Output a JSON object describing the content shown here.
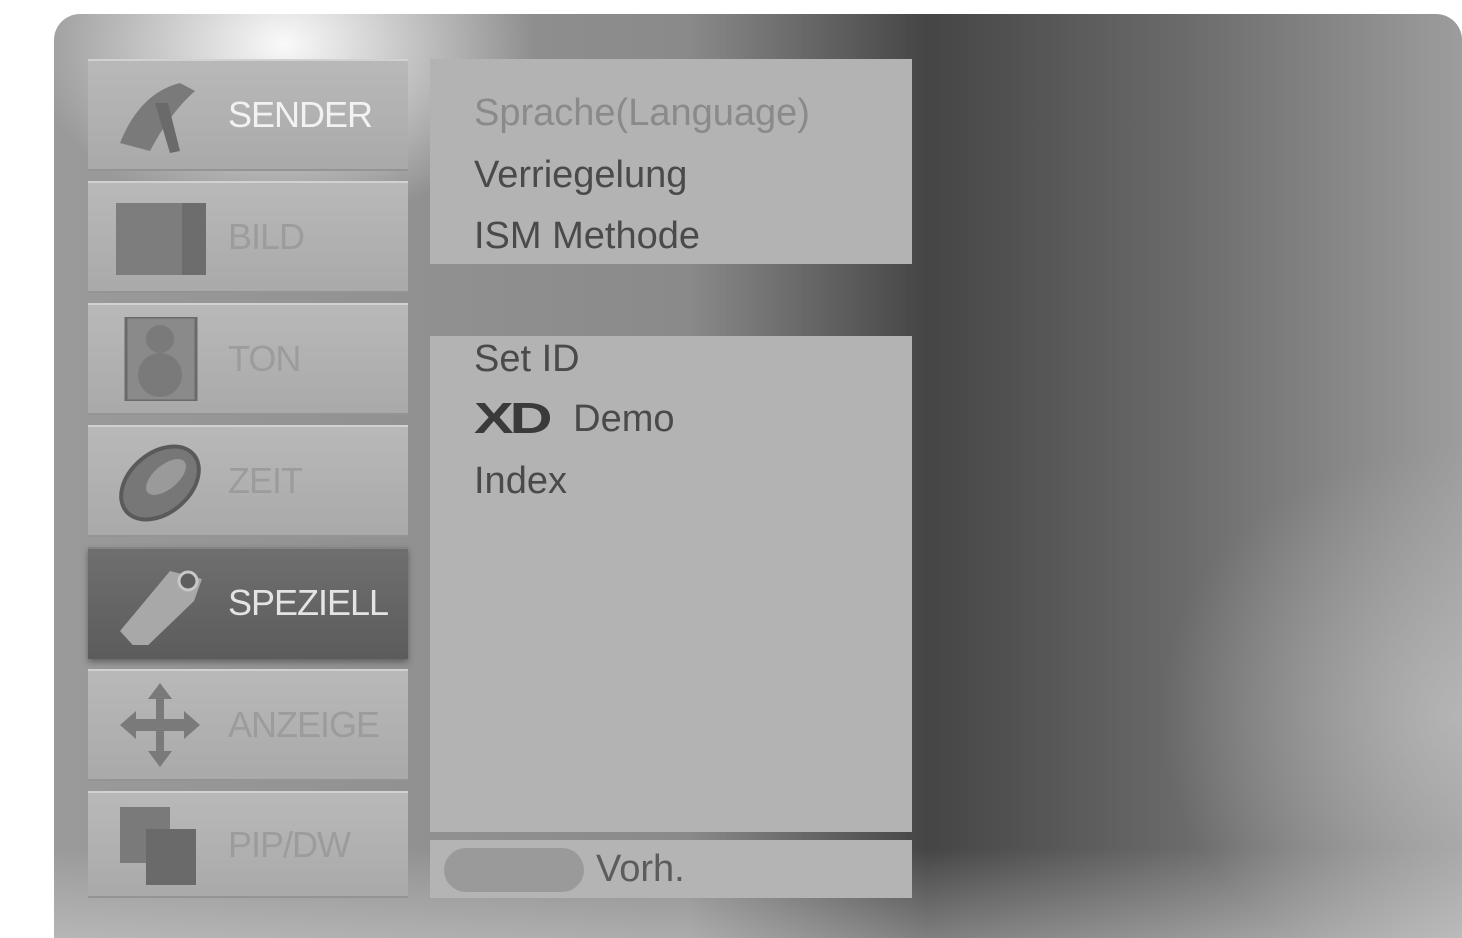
{
  "sidebar": {
    "items": [
      {
        "label": "SENDER",
        "icon": "satellite-dish-icon",
        "state": "normal"
      },
      {
        "label": "BILD",
        "icon": "picture-icon",
        "state": "dim"
      },
      {
        "label": "TON",
        "icon": "speaker-icon",
        "state": "dim"
      },
      {
        "label": "ZEIT",
        "icon": "clock-icon",
        "state": "dim"
      },
      {
        "label": "SPEZIELL",
        "icon": "tag-icon",
        "state": "selected"
      },
      {
        "label": "ANZEIGE",
        "icon": "move-arrows-icon",
        "state": "dim"
      },
      {
        "label": "PIP/DW",
        "icon": "pip-windows-icon",
        "state": "dim"
      }
    ]
  },
  "menu": {
    "top_items": [
      {
        "label": "Sprache(Language)",
        "state": "dim"
      },
      {
        "label": "Verriegelung",
        "state": "normal"
      },
      {
        "label": "ISM Methode",
        "state": "normal"
      }
    ],
    "main_items": [
      {
        "label": "Set ID"
      },
      {
        "logo": "XD",
        "label": "Demo"
      },
      {
        "label": "Index"
      }
    ]
  },
  "footer": {
    "key_color": "#9a9a9a",
    "label": "Vorh."
  },
  "colors": {
    "panel": "#b3b3b3",
    "selected_tab": "#666666",
    "text": "#4a4a4a"
  }
}
